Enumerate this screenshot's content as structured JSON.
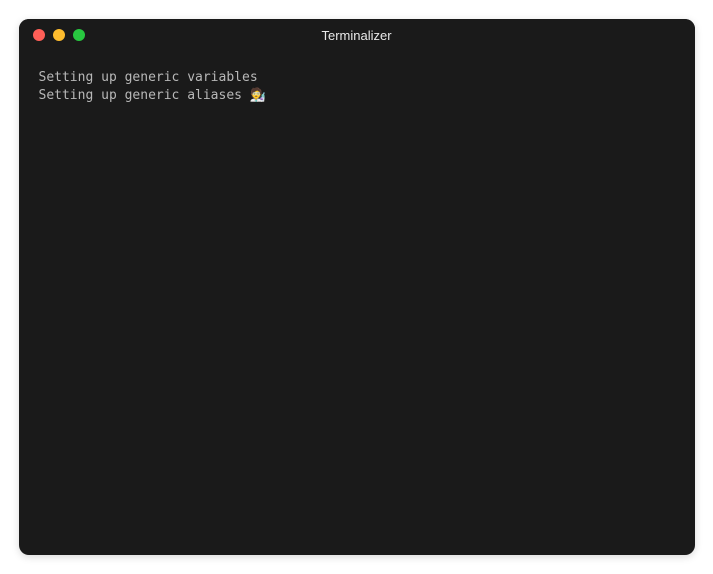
{
  "window": {
    "title": "Terminalizer"
  },
  "terminal": {
    "lines": [
      "Setting up generic variables",
      "Setting up generic aliases 🧑‍🔬"
    ]
  }
}
